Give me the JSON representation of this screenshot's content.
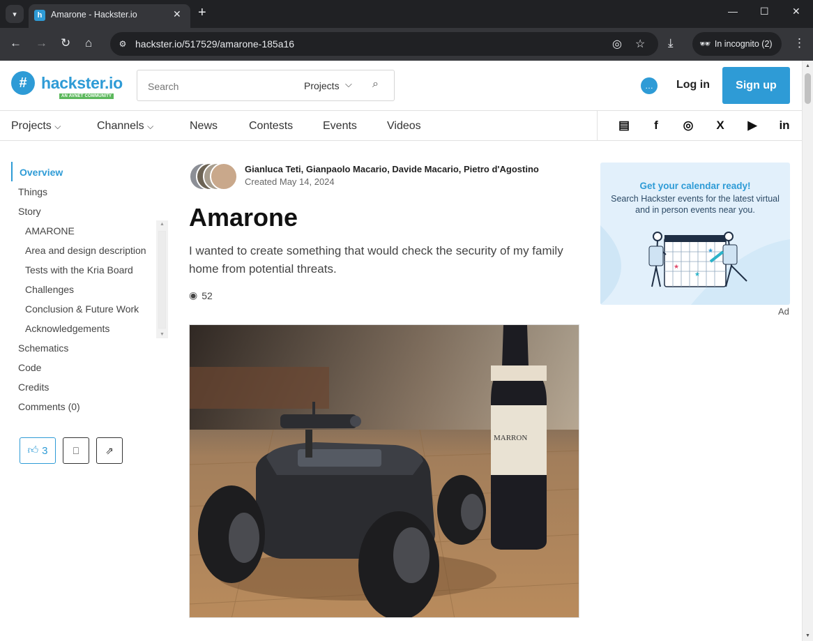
{
  "browser": {
    "tab_title": "Amarone - Hackster.io",
    "url": "hackster.io/517529/amarone-185a16",
    "incognito_label": "In incognito (2)"
  },
  "header": {
    "logo_text": "hackster.io",
    "logo_tagline": "AN AVNET COMMUNITY",
    "search_placeholder": "Search",
    "search_scope": "Projects",
    "login_label": "Log in",
    "signup_label": "Sign up"
  },
  "nav": {
    "items": [
      "Projects",
      "Channels",
      "News",
      "Contests",
      "Events",
      "Videos"
    ],
    "social": [
      "news-icon",
      "facebook-icon",
      "instagram-icon",
      "x-icon",
      "youtube-icon",
      "linkedin-icon"
    ]
  },
  "toc": {
    "items": [
      "Overview",
      "Things",
      "Story",
      "Schematics",
      "Code",
      "Credits",
      "Comments (0)"
    ],
    "story_sections": [
      "AMARONE",
      "Area and design description",
      "Tests with the Kria Board",
      "Challenges",
      "Conclusion & Future Work",
      "Acknowledgements"
    ]
  },
  "actions": {
    "like_count": "3"
  },
  "project": {
    "authors": "Gianluca Teti, Gianpaolo Macario, Davide Macario, Pietro d'Agostino",
    "created": "Created May 14, 2024",
    "title": "Amarone",
    "description": "I wanted to create something that would check the security of my family home from potential threats.",
    "views": "52"
  },
  "ad": {
    "headline": "Get your calendar ready!",
    "body": "Search Hackster events for the latest virtual and in person events near you.",
    "label": "Ad"
  },
  "hero_image": {
    "bottle_label_text": "MARRON"
  },
  "colors": {
    "brand": "#2e9bd6",
    "avnet_green": "#5cb85c"
  }
}
